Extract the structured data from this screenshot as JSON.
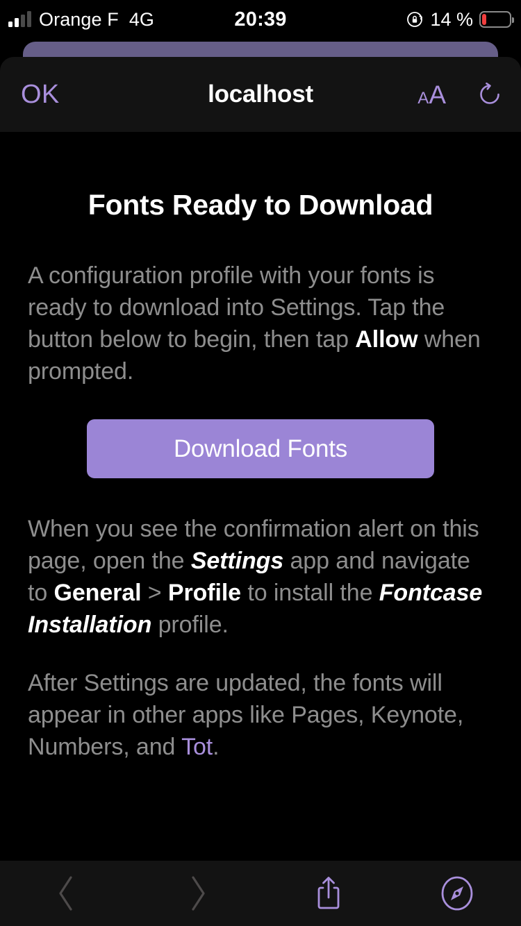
{
  "status_bar": {
    "carrier": "Orange F",
    "network": "4G",
    "time": "20:39",
    "battery_percent": "14 %",
    "battery_level": 14,
    "signal_bars_active": 2,
    "signal_bars_total": 4,
    "rotation_lock_icon": "rotation-lock-icon"
  },
  "nav_bar": {
    "ok_label": "OK",
    "title": "localhost",
    "text_size_small": "A",
    "text_size_large": "A",
    "reload_icon": "reload-icon"
  },
  "page": {
    "title": "Fonts Ready to Download",
    "paragraph1": {
      "part1": "A configuration profile with your fonts is ready to download into Settings. Tap the button below to begin, then tap ",
      "bold1": "Allow",
      "part2": " when prompted."
    },
    "button_label": "Download Fonts",
    "paragraph2": {
      "part1": "When you see the confirmation alert on this page, open the ",
      "bolditalic1": "Settings",
      "part2": " app and navigate to ",
      "bold1": "General",
      "part3": " > ",
      "bold2": "Profile",
      "part4": " to install the ",
      "bolditalic2": "Fontcase Installation",
      "part5": " profile."
    },
    "paragraph3": {
      "part1": "After Settings are updated, the fonts will appear in other apps like Pages, Keynote, Numbers, and ",
      "link": "Tot",
      "part2": "."
    }
  },
  "toolbar": {
    "back_icon": "chevron-left-icon",
    "forward_icon": "chevron-right-icon",
    "share_icon": "share-icon",
    "tabs_icon": "safari-compass-icon"
  },
  "colors": {
    "accent_purple": "#a98fdc",
    "button_purple": "#9b85d6",
    "sheet_purple": "#665e88",
    "body_text_gray": "#8e8e8e",
    "bar_background": "#131313",
    "page_background": "#000000",
    "battery_red": "#f03e3e"
  }
}
